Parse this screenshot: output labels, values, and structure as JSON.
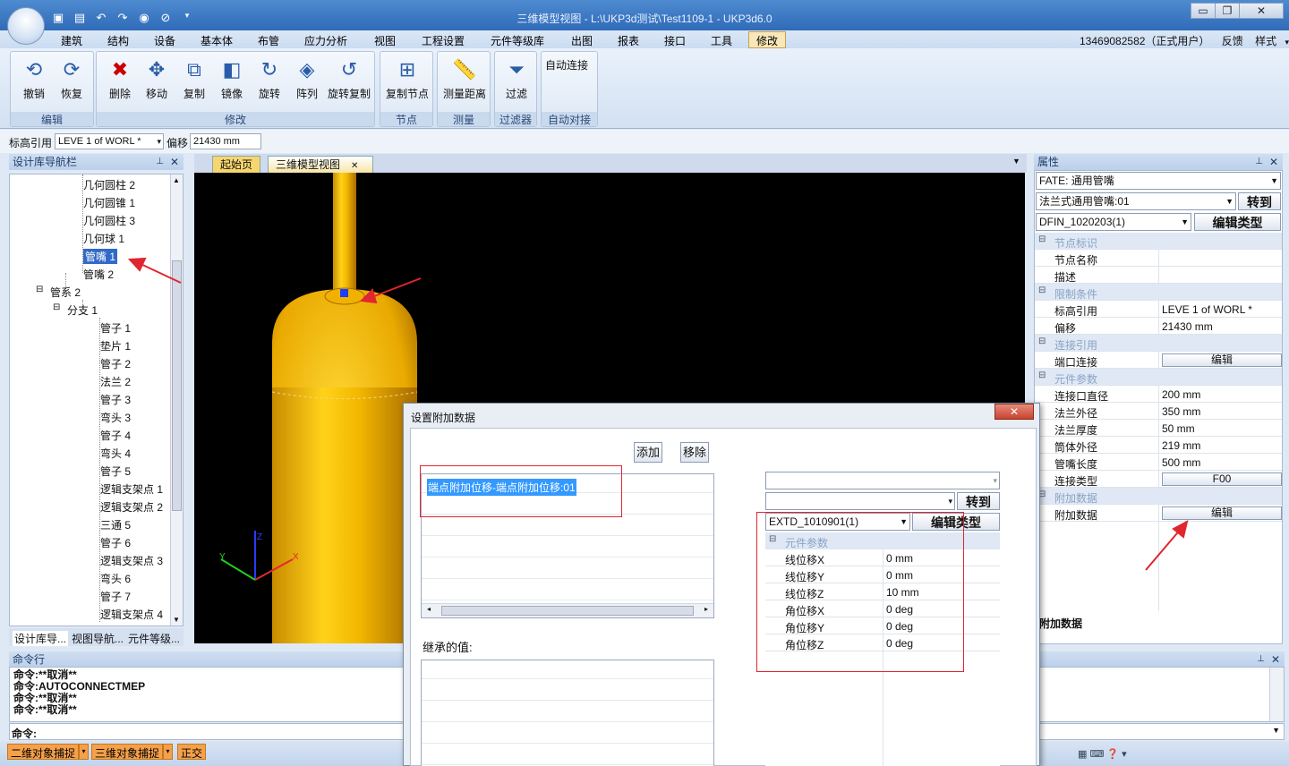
{
  "window": {
    "title": "三维模型视图 - L:\\UKP3d测试\\Test1109-1 - UKP3d6.0"
  },
  "menu": [
    "建筑",
    "结构",
    "设备",
    "基本体",
    "布管",
    "应力分析",
    "视图",
    "工程设置",
    "元件等级库",
    "出图",
    "报表",
    "接口",
    "工具",
    "修改"
  ],
  "user": {
    "info": "13469082582（正式用户）",
    "feedback": "反馈",
    "style": "样式"
  },
  "ribbon": {
    "groups": [
      {
        "label": "编辑",
        "buttons": [
          {
            "label": "撤销",
            "icon": "undo-icon"
          },
          {
            "label": "恢复",
            "icon": "redo-icon"
          }
        ]
      },
      {
        "label": "修改",
        "buttons": [
          {
            "label": "删除",
            "icon": "delete-icon"
          },
          {
            "label": "移动",
            "icon": "move-icon"
          },
          {
            "label": "复制",
            "icon": "copy-icon"
          },
          {
            "label": "镜像",
            "icon": "mirror-icon"
          },
          {
            "label": "旋转",
            "icon": "rotate-icon"
          },
          {
            "label": "阵列",
            "icon": "array-icon"
          },
          {
            "label": "旋转复制",
            "icon": "rotate-copy-icon"
          }
        ]
      },
      {
        "label": "节点",
        "buttons": [
          {
            "label": "复制节点",
            "icon": "copy-node-icon"
          }
        ]
      },
      {
        "label": "测量",
        "buttons": [
          {
            "label": "测量距离",
            "icon": "ruler-icon"
          }
        ]
      },
      {
        "label": "过滤器",
        "buttons": [
          {
            "label": "过滤",
            "icon": "filter-icon"
          }
        ]
      },
      {
        "label": "自动对接",
        "buttons": [
          {
            "label": "自动连接",
            "icon": ""
          }
        ]
      }
    ]
  },
  "bar2": {
    "elev_label": "标高引用",
    "elev_value": "LEVE 1 of WORL *",
    "offset_label": "偏移",
    "offset_value": "21430 mm"
  },
  "left_panel": {
    "title": "设计库导航栏",
    "tree": [
      "几何圆柱 2",
      "几何圆锥 1",
      "几何圆柱 3",
      "几何球 1",
      "管嘴 1",
      "管嘴 2",
      "管系 2",
      "分支 1",
      "管子 1",
      "垫片 1",
      "管子 2",
      "法兰 2",
      "管子 3",
      "弯头 3",
      "管子 4",
      "弯头 4",
      "管子 5",
      "逻辑支架点 1",
      "逻辑支架点 2",
      "三通 5",
      "管子 6",
      "逻辑支架点 3",
      "弯头 6",
      "管子 7",
      "逻辑支架点 4"
    ],
    "selected_index": 4,
    "tabs": [
      "设计库导...",
      "视图导航...",
      "元件等级..."
    ]
  },
  "doc_tabs": [
    "起始页",
    "三维模型视图"
  ],
  "right_panel": {
    "title": "属性",
    "fate": "FATE: 通用管嘴",
    "combo1": "法兰式通用管嘴:01",
    "goto": "转到",
    "combo2": "DFIN_1020203(1)",
    "edit_type": "编辑类型",
    "rows": [
      {
        "k": "节点标识",
        "cat": true
      },
      {
        "k": "节点名称",
        "v": ""
      },
      {
        "k": "描述",
        "v": ""
      },
      {
        "k": "限制条件",
        "cat": true
      },
      {
        "k": "标高引用",
        "v": "LEVE 1 of WORL *"
      },
      {
        "k": "偏移",
        "v": "21430 mm"
      },
      {
        "k": "连接引用",
        "cat": true
      },
      {
        "k": "端口连接",
        "v": "编辑",
        "btn": true
      },
      {
        "k": "元件参数",
        "cat": true
      },
      {
        "k": "连接口直径",
        "v": "200 mm"
      },
      {
        "k": "法兰外径",
        "v": "350 mm"
      },
      {
        "k": "法兰厚度",
        "v": "50 mm"
      },
      {
        "k": "筒体外径",
        "v": "219 mm"
      },
      {
        "k": "管嘴长度",
        "v": "500 mm"
      },
      {
        "k": "连接类型",
        "v": "F00",
        "btn": true
      },
      {
        "k": "附加数据",
        "cat": true
      },
      {
        "k": "附加数据",
        "v": "编辑",
        "btn": true
      }
    ],
    "footer": "附加数据"
  },
  "command": {
    "title": "命令行",
    "lines": [
      "命令:**取消**",
      "命令:AUTOCONNECTMEP",
      "命令:**取消**",
      "命令:**取消**"
    ],
    "prompt": "命令:"
  },
  "status": {
    "btn1": "二维对象捕捉",
    "btn2": "三维对象捕捉",
    "btn3": "正交"
  },
  "dialog": {
    "title": "设置附加数据",
    "add": "添加",
    "remove": "移除",
    "list_item": "端点附加位移-端点附加位移:01",
    "inherited_label": "继承的值:",
    "goto": "转到",
    "combo": "EXTD_1010901(1)",
    "edit_type": "编辑类型",
    "cat": "元件参数",
    "params": [
      {
        "k": "线位移X",
        "v": "0 mm"
      },
      {
        "k": "线位移Y",
        "v": "0 mm"
      },
      {
        "k": "线位移Z",
        "v": "10 mm"
      },
      {
        "k": "角位移X",
        "v": "0 deg"
      },
      {
        "k": "角位移Y",
        "v": "0 deg"
      },
      {
        "k": "角位移Z",
        "v": "0 deg"
      }
    ]
  },
  "axes": {
    "x": "X",
    "y": "Y",
    "z": "Z"
  }
}
